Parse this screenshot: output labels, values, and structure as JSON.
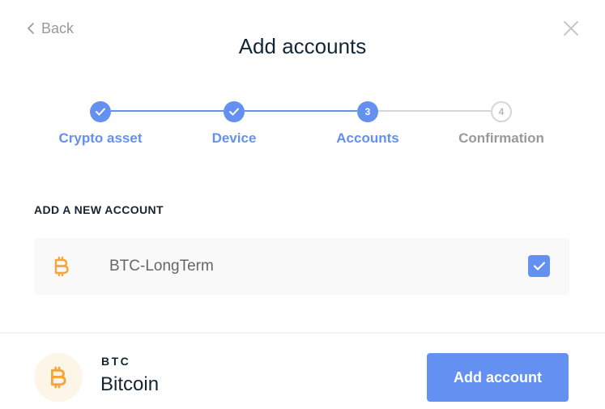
{
  "header": {
    "back_label": "Back",
    "title": "Add accounts"
  },
  "stepper": {
    "steps": [
      {
        "label": "Crypto asset",
        "state": "done",
        "number": "1"
      },
      {
        "label": "Device",
        "state": "done",
        "number": "2"
      },
      {
        "label": "Accounts",
        "state": "active",
        "number": "3"
      },
      {
        "label": "Confirmation",
        "state": "todo",
        "number": "4"
      }
    ]
  },
  "section": {
    "title": "ADD A NEW ACCOUNT"
  },
  "account": {
    "name": "BTC-LongTerm",
    "icon": "bitcoin-icon",
    "checked": true
  },
  "footer": {
    "ticker": "BTC",
    "name": "Bitcoin",
    "icon": "bitcoin-icon",
    "button_label": "Add account"
  },
  "colors": {
    "accent": "#6490f1",
    "bitcoin": "#f6a537",
    "text": "#142533",
    "muted": "#999999"
  }
}
